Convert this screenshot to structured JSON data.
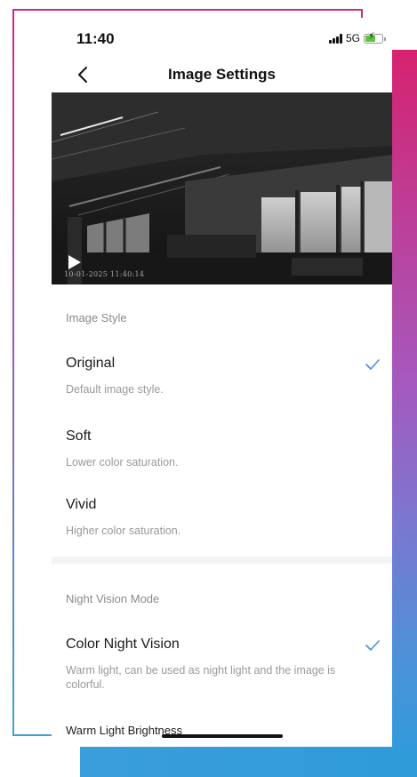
{
  "status_bar": {
    "time": "11:40",
    "network": "5G",
    "battery_charging": true
  },
  "header": {
    "title": "Image Settings",
    "back_icon": "chevron-left-icon"
  },
  "preview": {
    "timestamp": "10-01-2025 11:40:14",
    "play_icon": "play-icon"
  },
  "image_style": {
    "header": "Image Style",
    "options": [
      {
        "title": "Original",
        "description": "Default image style.",
        "selected": true
      },
      {
        "title": "Soft",
        "description": "Lower color saturation.",
        "selected": false
      },
      {
        "title": "Vivid",
        "description": "Higher color saturation.",
        "selected": false
      }
    ]
  },
  "night_vision": {
    "header": "Night Vision Mode",
    "options": [
      {
        "title": "Color Night Vision",
        "description": "Warm light, can be used as night light and the image is colorful.",
        "selected": true
      }
    ],
    "warm_light_label": "Warm Light Brightness"
  },
  "colors": {
    "accent_check": "#4a90e2",
    "frame_pink": "#cf2a7f",
    "frame_blue": "#3c9fd6"
  }
}
